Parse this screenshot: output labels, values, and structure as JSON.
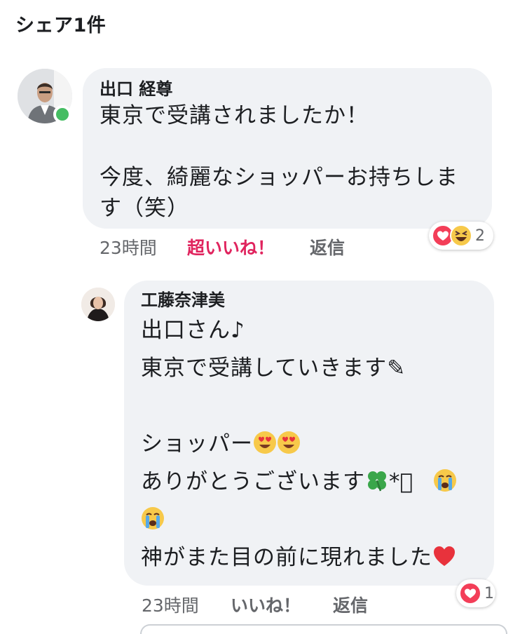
{
  "header": {
    "title": "シェア1件"
  },
  "comments": [
    {
      "author": "出口 経尊",
      "lines": [
        "東京で受講されましたか！",
        "",
        "今度、綺麗なショッパーお持ちしま",
        "す（笑）"
      ],
      "time": "23時間",
      "like_label": "超いいね！",
      "reply_label": "返信",
      "reaction_icons": [
        "love-reaction",
        "haha-reaction"
      ],
      "reaction_count": "2",
      "online": true
    },
    {
      "author": "工藤奈津美",
      "lines": [
        "出口さん♪",
        "東京で受講していきます✎",
        "",
        "ショッパー",
        "ありがとうございます",
        "",
        "神がまた目の前に現れました"
      ],
      "time": "23時間",
      "like_label": "いいね！",
      "reply_label": "返信",
      "reaction_icons": [
        "love-reaction"
      ],
      "reaction_count": "1"
    }
  ],
  "inline_text": {
    "clover_suffix": "*ﾟ"
  },
  "colors": {
    "bubble": "#f0f2f5",
    "love_active": "#e0245e",
    "online": "#45bd62",
    "meta": "#65676b"
  }
}
